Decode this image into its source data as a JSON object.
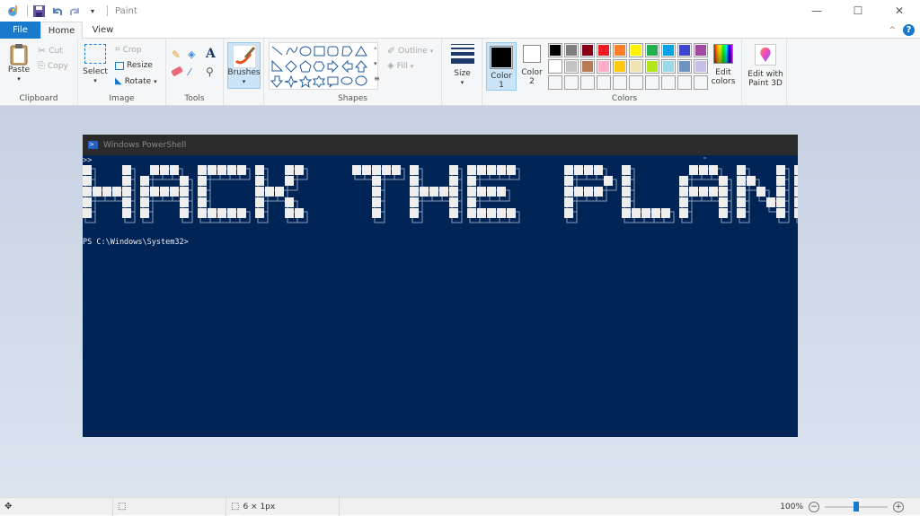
{
  "app": {
    "title": "Paint"
  },
  "window_controls": {
    "minimize": "—",
    "maximize": "☐",
    "close": "✕"
  },
  "tabs": [
    {
      "label": "File"
    },
    {
      "label": "Home"
    },
    {
      "label": "View"
    }
  ],
  "help": {
    "collapse": "^",
    "help": "?"
  },
  "clipboard": {
    "label": "Clipboard",
    "paste": "Paste",
    "cut": "Cut",
    "copy": "Copy"
  },
  "image": {
    "label": "Image",
    "select": "Select",
    "crop": "Crop",
    "resize": "Resize",
    "rotate": "Rotate"
  },
  "tools": {
    "label": "Tools"
  },
  "brushes": {
    "label": "Brushes"
  },
  "shapes": {
    "label": "Shapes",
    "outline": "Outline",
    "fill": "Fill"
  },
  "size": {
    "label": "Size"
  },
  "colors": {
    "label": "Colors",
    "color1": {
      "line1": "Color",
      "line2": "1",
      "value": "#000000"
    },
    "color2": {
      "line1": "Color",
      "line2": "2",
      "value": "#ffffff"
    },
    "palette_row1": [
      "#000000",
      "#7f7f7f",
      "#880015",
      "#ed1c24",
      "#ff7f27",
      "#fff200",
      "#22b14c",
      "#00a2e8",
      "#3f48cc",
      "#a349a4"
    ],
    "palette_row2": [
      "#ffffff",
      "#c3c3c3",
      "#b97a57",
      "#ffaec9",
      "#ffc90e",
      "#efe4b0",
      "#b5e61d",
      "#99d9ea",
      "#7092be",
      "#c8bfe7"
    ],
    "palette_row3": [
      "",
      "",
      "",
      "",
      "",
      "",
      "",
      "",
      "",
      ""
    ],
    "edit_colors": {
      "line1": "Edit",
      "line2": "colors"
    },
    "edit_3d": {
      "line1": "Edit with",
      "line2": "Paint 3D"
    }
  },
  "canvas": {
    "window_title": "Windows PowerShell",
    "prompt_continuation": ">>",
    "banner_text": "HACK THE PLANET!",
    "prompt": "PS C:\\Windows\\System32>"
  },
  "status": {
    "selection_size": "",
    "image_size": "6 × 1px",
    "zoom": "100%",
    "zoom_level_fraction": 0.5
  }
}
